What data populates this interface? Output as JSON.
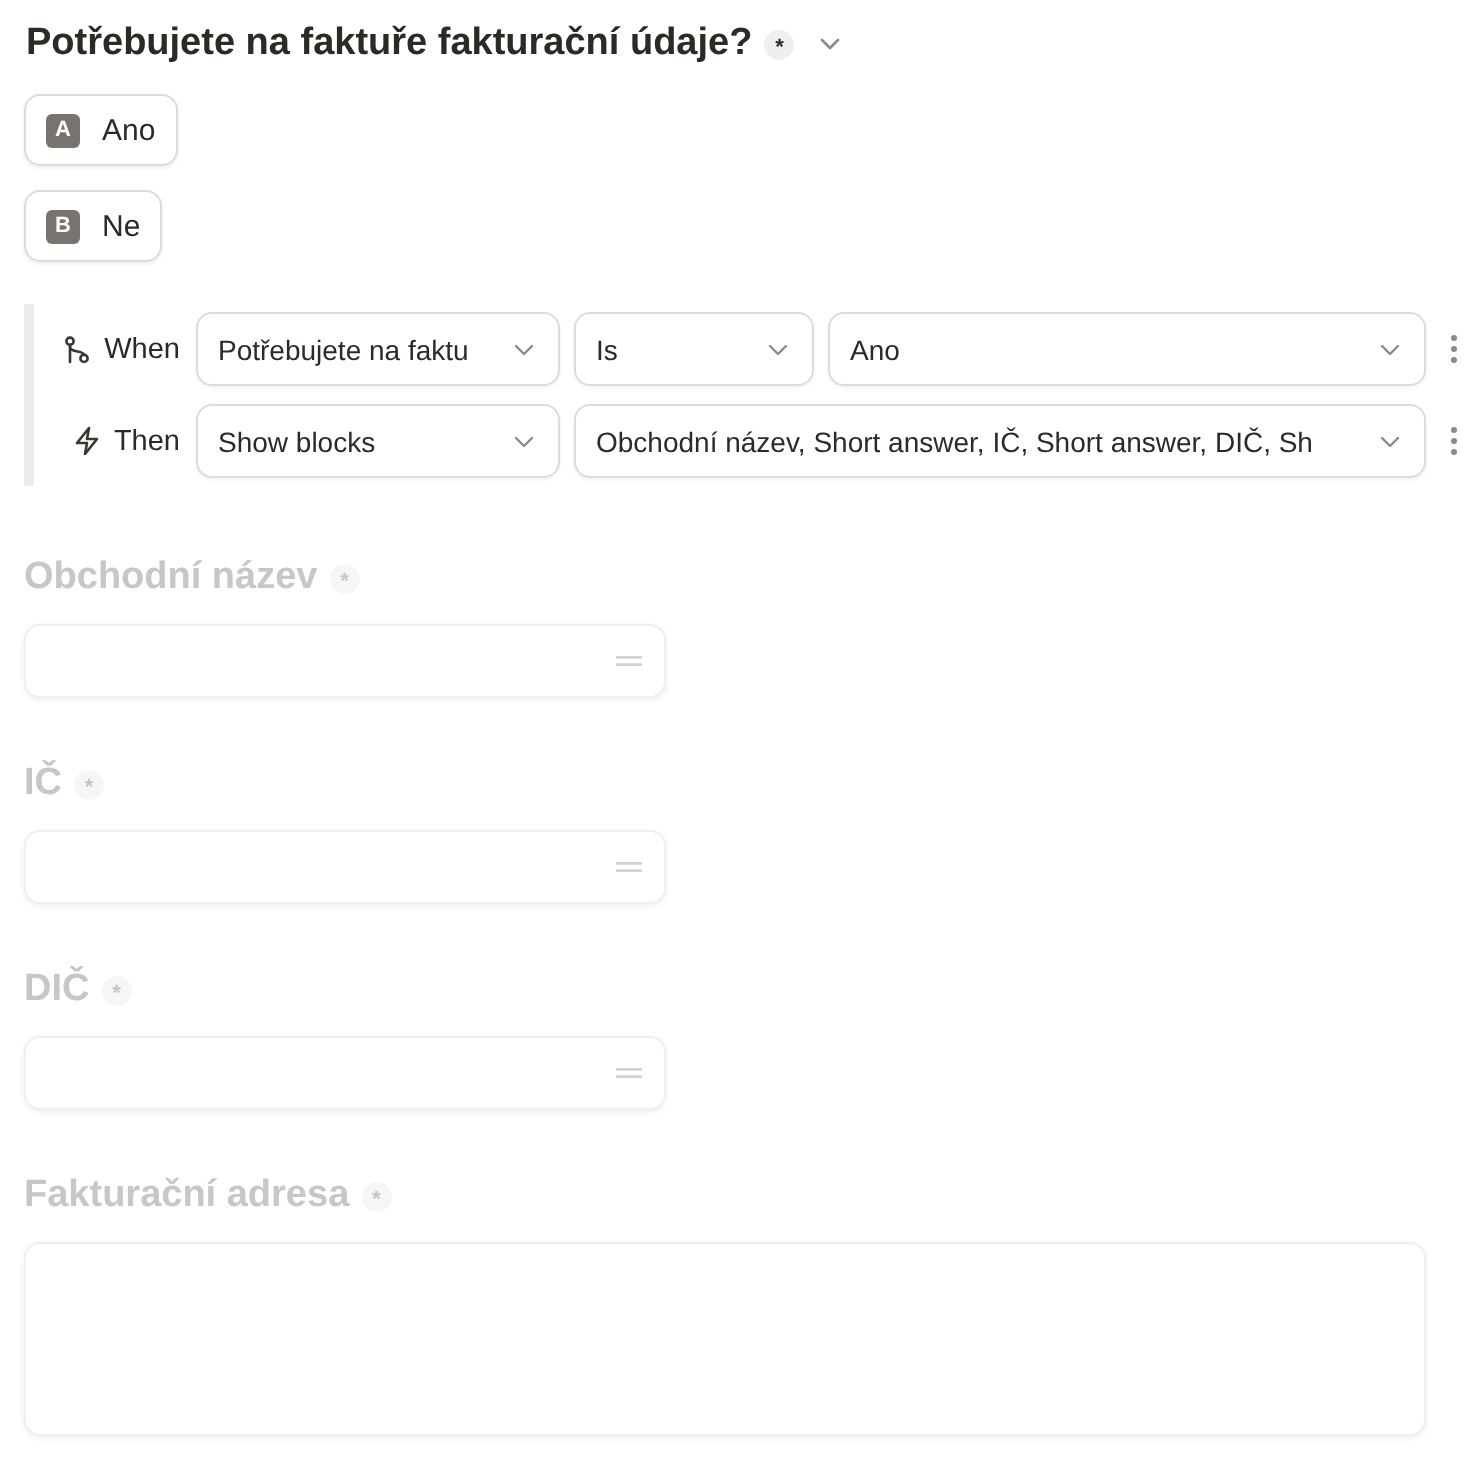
{
  "question": {
    "title": "Potřebujete na faktuře fakturační údaje?",
    "required_mark": "*",
    "options": [
      {
        "key": "A",
        "label": "Ano"
      },
      {
        "key": "B",
        "label": "Ne"
      }
    ]
  },
  "logic": {
    "rows": [
      {
        "kind": "when",
        "label": "When",
        "selects": [
          "Potřebujete na faktu",
          "Is",
          "Ano"
        ]
      },
      {
        "kind": "then",
        "label": "Then",
        "selects": [
          "Show blocks",
          "Obchodní název, Short answer, IČ, Short answer, DIČ, Sh"
        ]
      }
    ]
  },
  "blocks": [
    {
      "kind": "short",
      "label": "Obchodní název",
      "required_mark": "*",
      "dimmed": true
    },
    {
      "kind": "short",
      "label": "IČ",
      "required_mark": "*",
      "dimmed": true
    },
    {
      "kind": "short",
      "label": "DIČ",
      "required_mark": "*",
      "dimmed": true
    },
    {
      "kind": "long",
      "label": "Fakturační adresa",
      "required_mark": "*",
      "dimmed": true
    }
  ]
}
